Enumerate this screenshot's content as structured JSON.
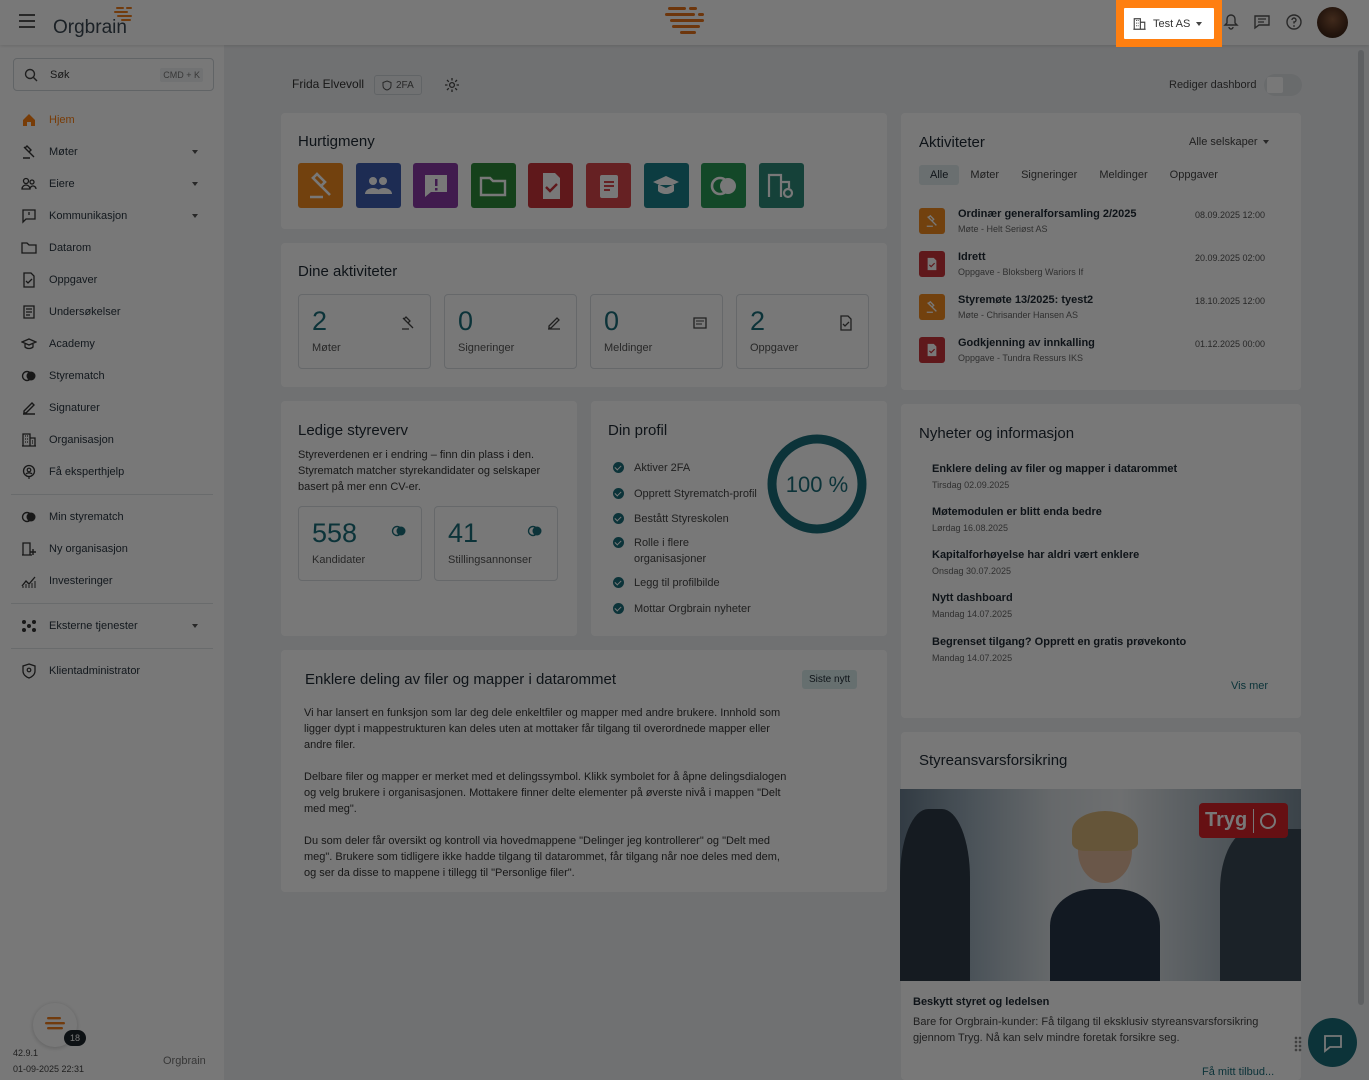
{
  "topbar": {
    "brand": "Orgbrain",
    "company": "Test AS"
  },
  "sidebar": {
    "search_placeholder": "Søk",
    "search_shortcut": "CMD + K",
    "items": [
      {
        "label": "Hjem"
      },
      {
        "label": "Møter"
      },
      {
        "label": "Eiere"
      },
      {
        "label": "Kommunikasjon"
      },
      {
        "label": "Datarom"
      },
      {
        "label": "Oppgaver"
      },
      {
        "label": "Undersøkelser"
      },
      {
        "label": "Academy"
      },
      {
        "label": "Styrematch"
      },
      {
        "label": "Signaturer"
      },
      {
        "label": "Organisasjon"
      },
      {
        "label": "Få eksperthjelp"
      },
      {
        "label": "Min styrematch"
      },
      {
        "label": "Ny organisasjon"
      },
      {
        "label": "Investeringer"
      },
      {
        "label": "Eksterne tjenester"
      },
      {
        "label": "Klientadministrator"
      }
    ],
    "version": "42.9.1",
    "build_date": "01-09-2025 22:31",
    "bot_badge": "18",
    "footer_brand": "Orgbrain"
  },
  "header": {
    "user_name": "Frida Elvevoll",
    "twofa": "2FA",
    "edit_dashboard": "Rediger dashbord"
  },
  "quickmenu": {
    "title": "Hurtigmeny",
    "colors": [
      "#f28a1e",
      "#3f5fb0",
      "#8a3aa6",
      "#2e8a3a",
      "#c9343a",
      "#d9474c",
      "#1b7f8a",
      "#2a9a55",
      "#2d8a7a"
    ],
    "icons": [
      "gavel-icon",
      "group-icon",
      "alert-message-icon",
      "folder-icon",
      "task-icon",
      "clipboard-icon",
      "academy-icon",
      "styrematch-icon",
      "org-settings-icon"
    ]
  },
  "activities": {
    "title": "Dine aktiviteter",
    "stats": [
      {
        "value": "2",
        "label": "Møter"
      },
      {
        "value": "0",
        "label": "Signeringer"
      },
      {
        "value": "0",
        "label": "Meldinger"
      },
      {
        "value": "2",
        "label": "Oppgaver"
      }
    ]
  },
  "vacancies": {
    "title": "Ledige styreverv",
    "text": "Styreverdenen er i endring – finn din plass i den. Styrematch matcher styrekandidater og selskaper basert på mer enn CV-er.",
    "candidates": {
      "value": "558",
      "label": "Kandidater"
    },
    "ads": {
      "value": "41",
      "label": "Stillingsannonser"
    }
  },
  "profile": {
    "title": "Din profil",
    "progress_text": "100 %",
    "progress": 1.0,
    "checks": [
      "Aktiver 2FA",
      "Opprett Styrematch-profil",
      "Bestått Styreskolen",
      "Rolle i flere organisasjoner",
      "Legg til profilbilde",
      "Mottar Orgbrain nyheter"
    ]
  },
  "article": {
    "title": "Enklere deling av filer og mapper i datarommet",
    "badge": "Siste nytt",
    "p1": "Vi har lansert en funksjon som lar deg dele enkeltfiler og mapper med andre brukere. Innhold som ligger dypt i mappestrukturen kan deles uten at mottaker får tilgang til overordnede mapper eller andre filer.",
    "p2": "Delbare filer og mapper er merket med et delingssymbol. Klikk symbolet for å åpne delingsdialogen og velg brukere i organisasjonen. Mottakere finner delte elementer på øverste nivå i mappen \"Delt med meg\".",
    "p3": "Du som deler får oversikt og kontroll via hovedmappene \"Delinger jeg kontrollerer\" og \"Delt med meg\". Brukere som tidligere ikke hadde tilgang til datarommet, får tilgang når noe deles med dem, og ser da disse to mappene i tillegg til \"Personlige filer\"."
  },
  "feed": {
    "title": "Aktiviteter",
    "filter": "Alle selskaper",
    "tabs": [
      "Alle",
      "Møter",
      "Signeringer",
      "Meldinger",
      "Oppgaver"
    ],
    "items": [
      {
        "title": "Ordinær generalforsamling 2/2025",
        "sub": "Møte - Helt Seriøst AS",
        "date": "08.09.2025 12:00",
        "color": "#f28a1e"
      },
      {
        "title": "Idrett",
        "sub": "Oppgave - Bloksberg Wariors If",
        "date": "20.09.2025 02:00",
        "color": "#c9343a"
      },
      {
        "title": "Styremøte 13/2025: tyest2",
        "sub": "Møte - Chrisander Hansen AS",
        "date": "18.10.2025 12:00",
        "color": "#f28a1e"
      },
      {
        "title": "Godkjenning av innkalling",
        "sub": "Oppgave - Tundra Ressurs IKS",
        "date": "01.12.2025 00:00",
        "color": "#c9343a"
      }
    ]
  },
  "news": {
    "title": "Nyheter og informasjon",
    "items": [
      {
        "title": "Enklere deling av filer og mapper i datarommet",
        "date": "Tirsdag 02.09.2025"
      },
      {
        "title": "Møtemodulen er blitt enda bedre",
        "date": "Lørdag 16.08.2025"
      },
      {
        "title": "Kapitalforhøyelse har aldri vært enklere",
        "date": "Onsdag 30.07.2025"
      },
      {
        "title": "Nytt dashboard",
        "date": "Mandag 14.07.2025"
      },
      {
        "title": "Begrenset tilgang? Opprett en gratis prøvekonto",
        "date": "Mandag 14.07.2025"
      }
    ],
    "more": "Vis mer"
  },
  "insurance": {
    "title": "Styreansvarsforsikring",
    "brand": "Tryg",
    "heading": "Beskytt styret og ledelsen",
    "text": "Bare for Orgbrain-kunder: Få tilgang til eksklusiv styreansvarsforsikring gjennom Tryg. Nå kan selv mindre foretak forsikre seg.",
    "cta": "Få mitt tilbud..."
  }
}
